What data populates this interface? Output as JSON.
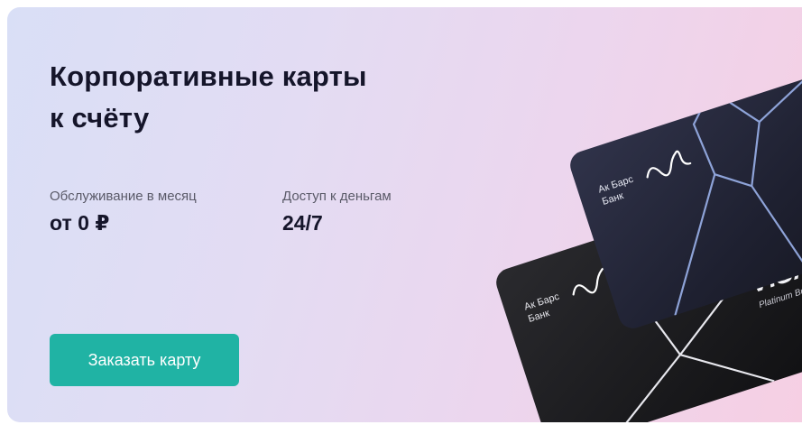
{
  "hero": {
    "title_line1": "Корпоративные карты",
    "title_line2": "к счёту"
  },
  "stats": [
    {
      "label": "Обслуживание в месяц",
      "value": "от 0 ₽"
    },
    {
      "label": "Доступ к деньгам",
      "value": "24/7"
    }
  ],
  "cta": {
    "label": "Заказать карту"
  },
  "cards": {
    "bank_name_line1": "Ак Барс",
    "bank_name_line2": "Банк",
    "network": "VISA",
    "tier": "Platinum Bu"
  },
  "colors": {
    "accent": "#20b3a4",
    "text_dark": "#15152a",
    "card_back": "#1c1c20",
    "card_front": "#242634"
  }
}
